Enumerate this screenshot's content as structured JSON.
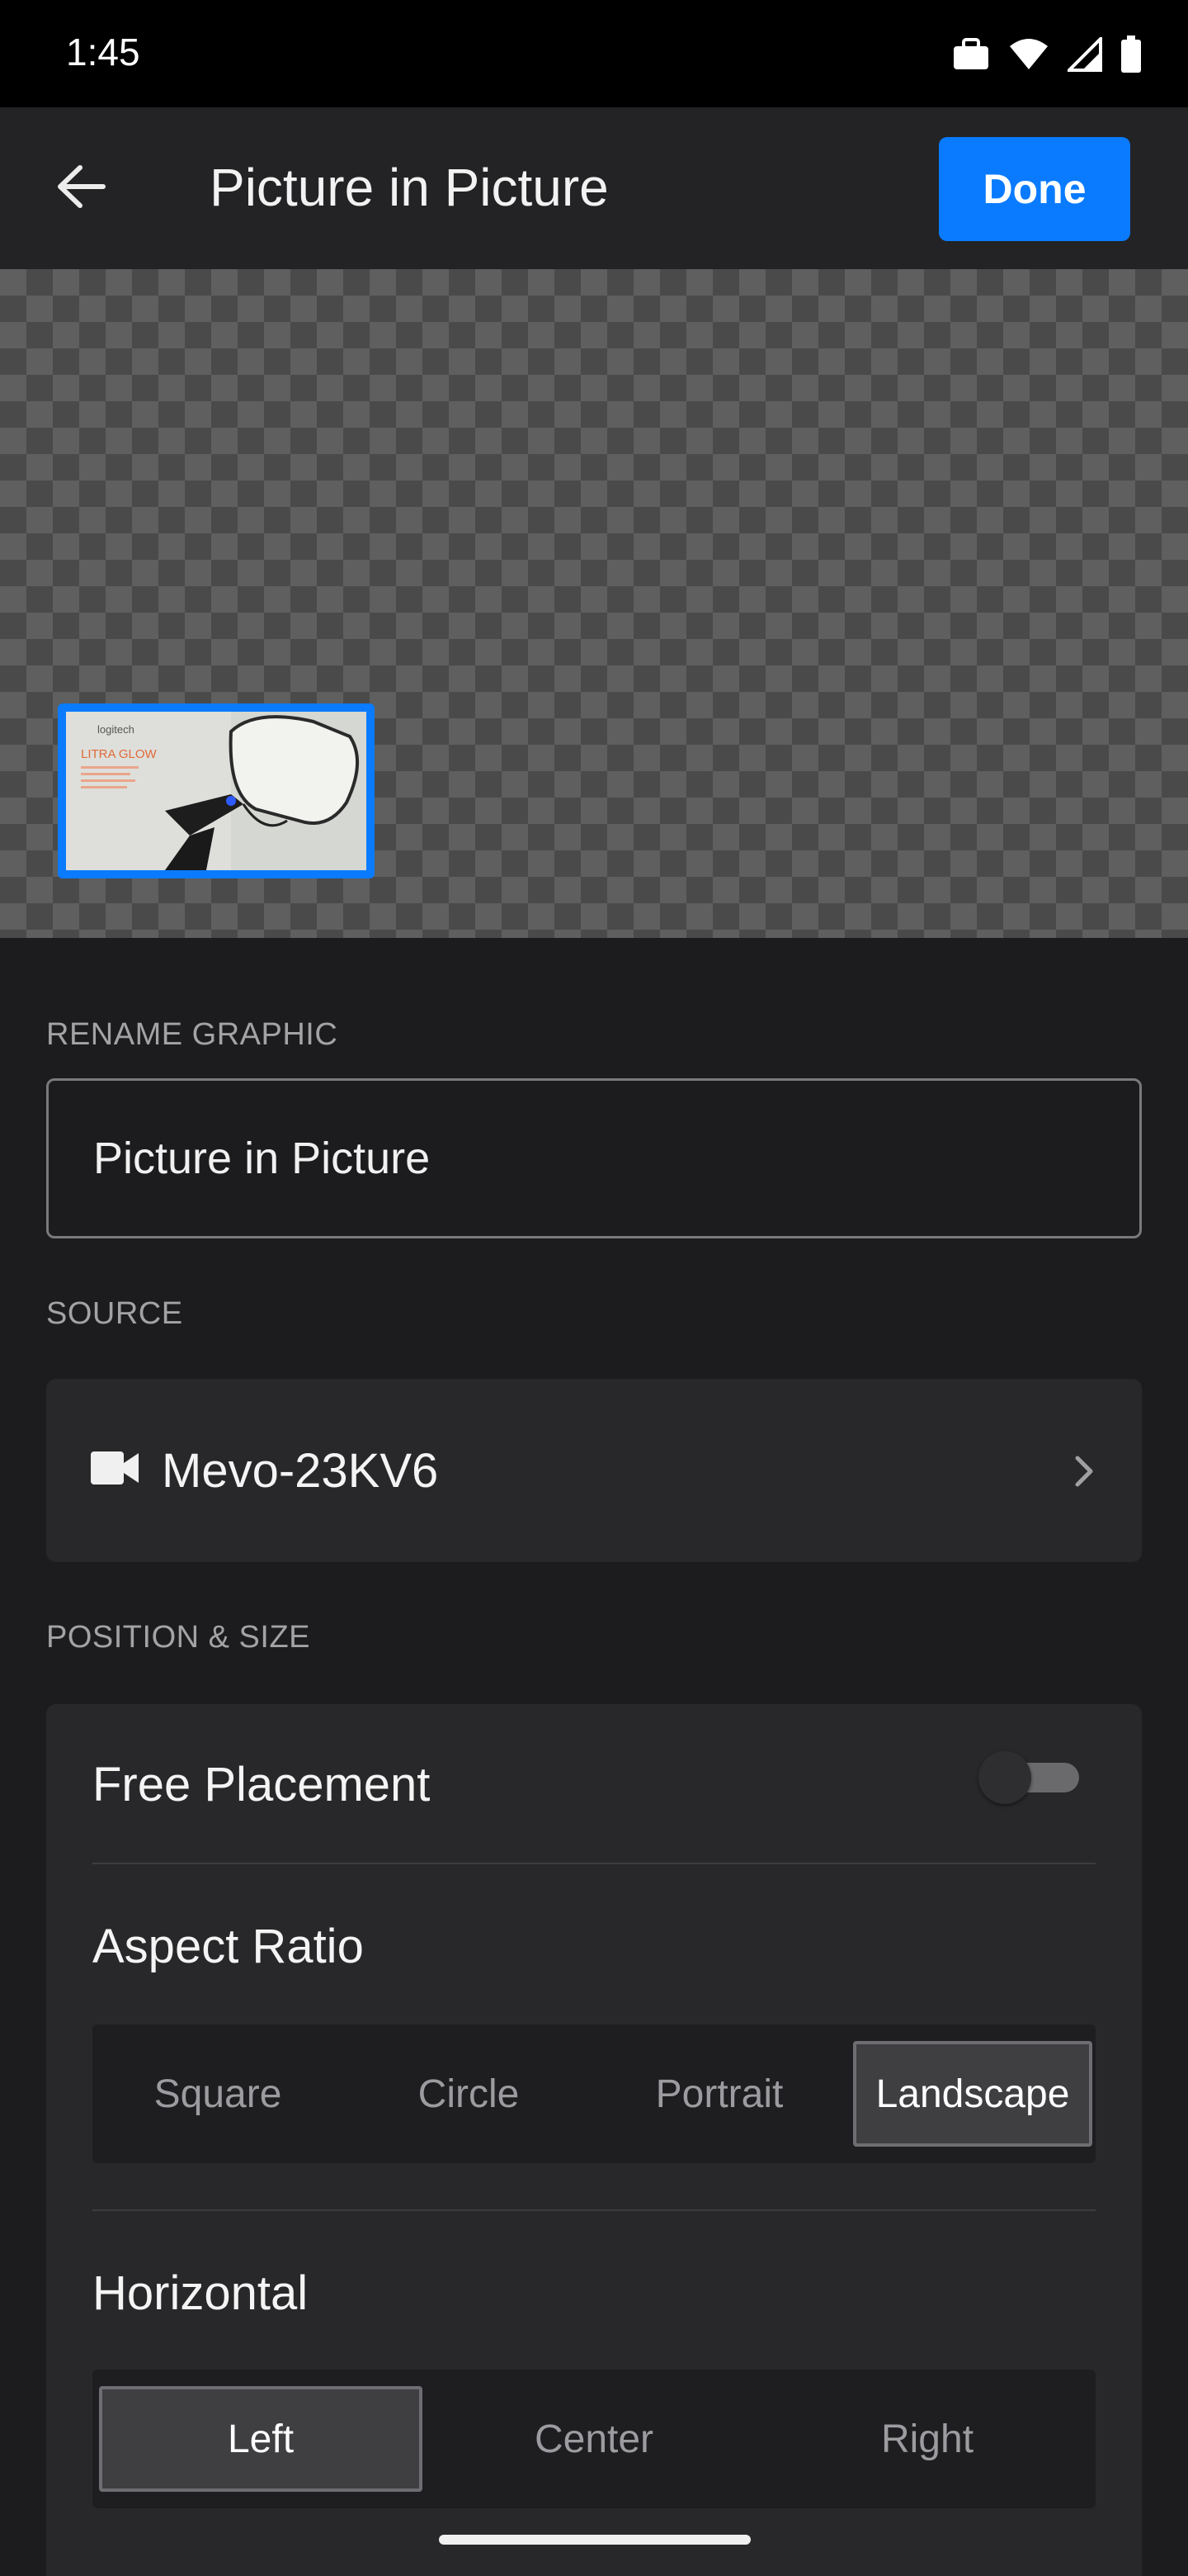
{
  "status_bar": {
    "time": "1:45"
  },
  "app_bar": {
    "title": "Picture in Picture",
    "done_label": "Done"
  },
  "preview": {
    "pip_brand_text": "logitech",
    "pip_product_text": "LITRA GLOW",
    "accent_color": "#0a7bff"
  },
  "rename": {
    "label": "RENAME GRAPHIC",
    "value": "Picture in Picture"
  },
  "source": {
    "label": "SOURCE",
    "device_name": "Mevo-23KV6",
    "icon": "video-camera-icon"
  },
  "position_size": {
    "label": "POSITION & SIZE",
    "free_placement": {
      "label": "Free Placement",
      "enabled": false
    },
    "aspect_ratio": {
      "label": "Aspect Ratio",
      "options": [
        "Square",
        "Circle",
        "Portrait",
        "Landscape"
      ],
      "selected": "Landscape"
    },
    "horizontal": {
      "label": "Horizontal",
      "options": [
        "Left",
        "Center",
        "Right"
      ],
      "selected": "Left"
    }
  }
}
